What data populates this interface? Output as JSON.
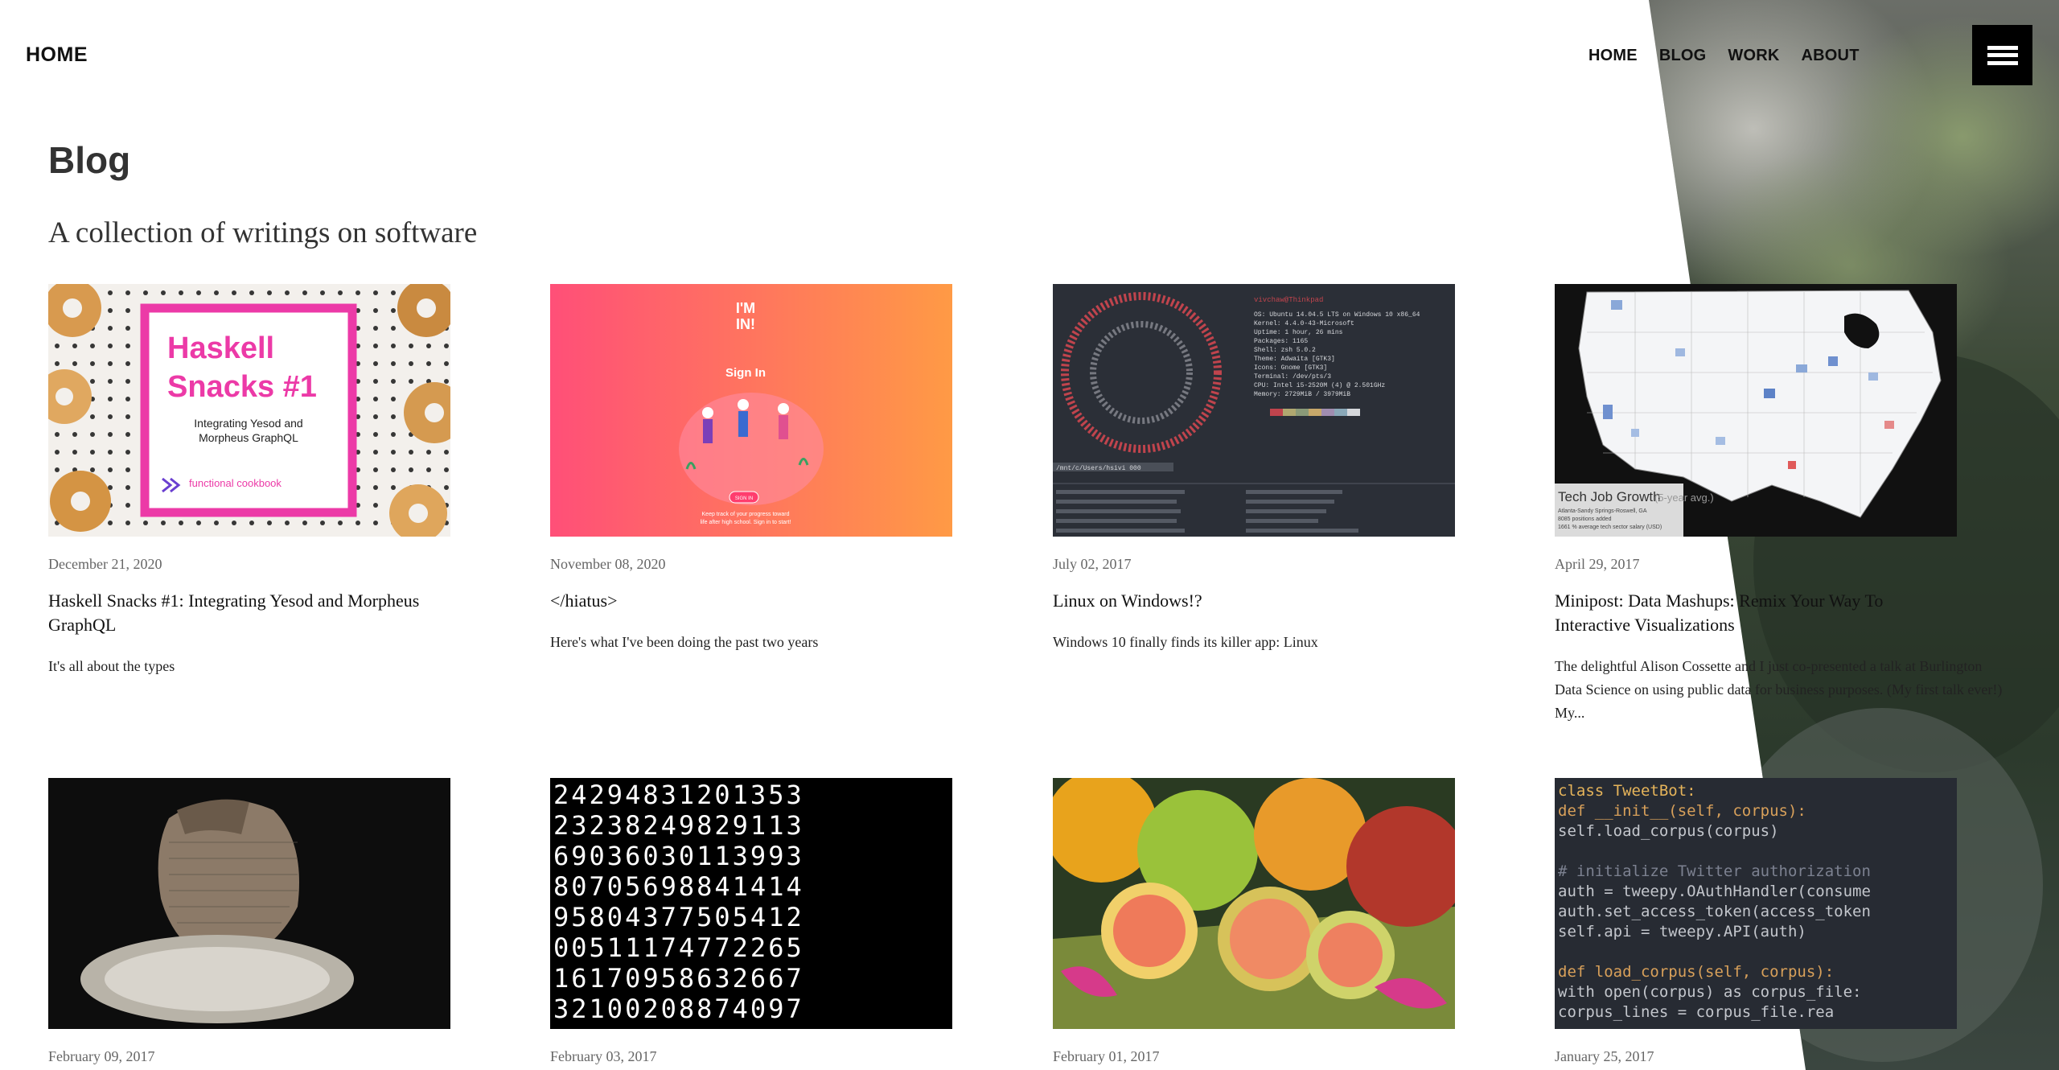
{
  "header": {
    "brand": "HOME",
    "nav": [
      {
        "label": "HOME"
      },
      {
        "label": "BLOG"
      },
      {
        "label": "WORK"
      },
      {
        "label": "ABOUT"
      }
    ],
    "menu_icon": "hamburger-menu-icon"
  },
  "page": {
    "title": "Blog",
    "subtitle": "A collection of writings on software"
  },
  "posts": [
    {
      "date": "December 21, 2020",
      "title": "Haskell Snacks #1: Integrating Yesod and Morpheus GraphQL",
      "excerpt": "It's all about the types",
      "thumb": {
        "heading1": "Haskell",
        "heading2": "Snacks #1",
        "sub1": "Integrating Yesod and",
        "sub2": "Morpheus GraphQL",
        "brand": "functional cookbook"
      }
    },
    {
      "date": "November 08, 2020",
      "title": "</hiatus>",
      "excerpt": "Here's what I've been doing the past two years",
      "thumb": {
        "logo1": "I'M",
        "logo2": "IN!",
        "heading": "Sign In",
        "button": "SIGN IN",
        "note1": "Keep track of your progress toward",
        "note2": "life after high school. Sign in to start!"
      }
    },
    {
      "date": "July 02, 2017",
      "title": "Linux on Windows!?",
      "excerpt": "Windows 10 finally finds its killer app: Linux",
      "thumb": {
        "user": "vivchaw@Thinkpad",
        "os": "OS: Ubuntu 14.04.5 LTS on Windows 10 x86_64",
        "kernel": "Kernel: 4.4.0-43-Microsoft",
        "uptime": "Uptime: 1 hour, 26 mins",
        "packages": "Packages: 1165",
        "shell": "Shell: zsh 5.0.2",
        "theme": "Theme: Adwaita [GTK3]",
        "icons": "Icons: Gnome [GTK3]",
        "terminal": "Terminal: /dev/pts/3",
        "cpu": "CPU: Intel i5-2520M (4) @ 2.501GHz",
        "memory": "Memory: 2729MiB / 3979MiB",
        "prompt": "/mnt/c/Users/hsivi 000"
      }
    },
    {
      "date": "April 29, 2017",
      "title": "Minipost: Data Mashups: Remix Your Way To Interactive Visualizations",
      "excerpt": "The delightful Alison Cossette and I just co-presented a talk at Burlington Data Science on using public data for business purposes. (My first talk ever!) My...",
      "thumb": {
        "caption": "Tech Job Growth",
        "caption_note": "(5-year avg.)",
        "legend1": "Atlanta-Sandy Springs-Roswell, GA",
        "legend2": "8085 positions added",
        "legend3": "1661 % average tech sector salary (USD)"
      }
    },
    {
      "date": "February 09, 2017",
      "title": "",
      "excerpt": "",
      "thumb": {}
    },
    {
      "date": "February 03, 2017",
      "title": "",
      "excerpt": "",
      "thumb": {
        "rows": [
          "24294831201353",
          "23238249829113",
          "69036030113993",
          "80705698841414",
          "95804377505412",
          "00511174772265",
          "16170958632667",
          "32100208874097"
        ]
      }
    },
    {
      "date": "February 01, 2017",
      "title": "",
      "excerpt": "",
      "thumb": {}
    },
    {
      "date": "January 25, 2017",
      "title": "",
      "excerpt": "",
      "thumb": {
        "code": [
          "class TweetBot:",
          "    def __init__(self, corpus):",
          "        self.load_corpus(corpus)",
          "",
          "        # initialize Twitter authorization",
          "        auth = tweepy.OAuthHandler(consume",
          "        auth.set_access_token(access_token",
          "        self.api = tweepy.API(auth)",
          "",
          "    def load_corpus(self, corpus):",
          "        with open(corpus) as corpus_file:",
          "            corpus_lines = corpus_file.rea"
        ]
      }
    }
  ],
  "colors": {
    "accent_pink": "#ec3aa7",
    "terminal_bg": "#2b2f37",
    "code_bg": "#272b33"
  }
}
